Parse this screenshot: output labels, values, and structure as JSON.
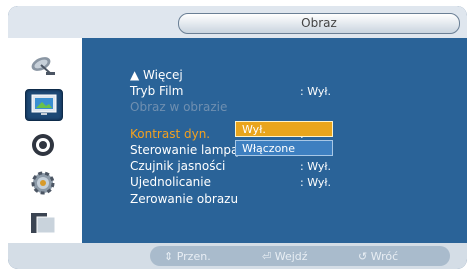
{
  "header": {
    "title": "Obraz"
  },
  "sidebar": {
    "items": [
      {
        "icon": "satellite-dish-icon"
      },
      {
        "icon": "picture-icon"
      },
      {
        "icon": "speaker-icon"
      },
      {
        "icon": "gear-icon"
      },
      {
        "icon": "multi-window-icon"
      }
    ]
  },
  "menu": {
    "more": "▲ Więcej",
    "rows": [
      {
        "label": "Tryb Film",
        "value": ": Wył."
      },
      {
        "label": "Obraz w obrazie",
        "value": ""
      },
      {
        "label": "Kontrast dyn.",
        "value": ":"
      },
      {
        "label": "Sterowanie lampą",
        "value": ":"
      },
      {
        "label": "Czujnik jasności",
        "value": ": Wył."
      },
      {
        "label": "Ujednolicanie",
        "value": ": Wył."
      },
      {
        "label": "Zerowanie obrazu",
        "value": ""
      }
    ]
  },
  "dropdown": {
    "options": [
      "Wył.",
      "Włączone"
    ]
  },
  "footer": {
    "move": "Przen.",
    "enter": "Wejdź",
    "back": "Wróć"
  },
  "colors": {
    "highlight": "#f2a020",
    "panel": "#2a6398"
  }
}
